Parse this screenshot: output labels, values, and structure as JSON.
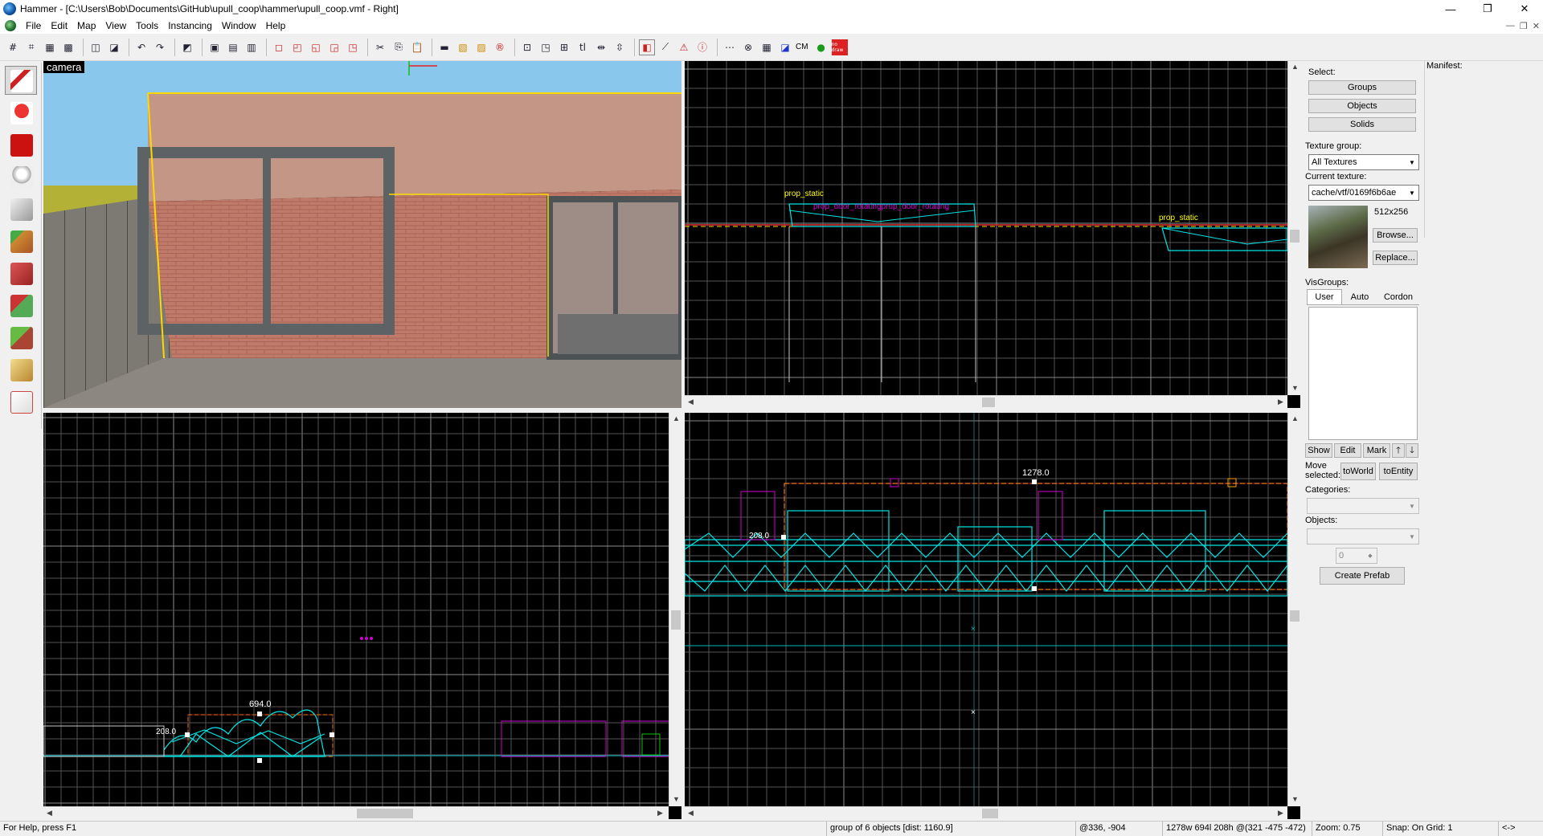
{
  "window": {
    "title": "Hammer - [C:\\Users\\Bob\\Documents\\GitHub\\upull_coop\\hammer\\upull_coop.vmf - Right]",
    "minimize": "—",
    "maximize": "❐",
    "close": "✕"
  },
  "menu": [
    "File",
    "Edit",
    "Map",
    "View",
    "Tools",
    "Instancing",
    "Window",
    "Help"
  ],
  "toolbar": {
    "cm_label": "CM",
    "nodraw_label": "no draw"
  },
  "camera_viewport": {
    "label": "camera"
  },
  "top_right_view": {
    "label_prop_static_1": "prop_static",
    "label_door": "prop_door_rotatingprop_door_rotating",
    "label_prop_static_2": "prop_static"
  },
  "bottom_left_view": {
    "width_readout": "694.0",
    "height_readout": "208.0"
  },
  "bottom_right_view": {
    "width_readout": "1278.0",
    "height_readout": "208.0"
  },
  "select_panel": {
    "title": "Select:",
    "groups": "Groups",
    "objects": "Objects",
    "solids": "Solids"
  },
  "texture_panel": {
    "group_label": "Texture group:",
    "group_value": "All Textures",
    "current_label": "Current texture:",
    "current_value": "cache/vtf/0169f6b6ae",
    "size": "512x256",
    "browse": "Browse...",
    "replace": "Replace..."
  },
  "visgroups": {
    "label": "VisGroups:",
    "tabs": [
      "User",
      "Auto",
      "Cordon"
    ],
    "show": "Show",
    "edit": "Edit",
    "mark": "Mark",
    "up": "🡑",
    "down": "🡓",
    "move_selected": "Move selected:",
    "to_world": "toWorld",
    "to_entity": "toEntity"
  },
  "prefab": {
    "categories_label": "Categories:",
    "objects_label": "Objects:",
    "count": "0",
    "create": "Create Prefab"
  },
  "manifest": {
    "label": "Manifest:"
  },
  "statusbar": {
    "help": "For Help, press F1",
    "selection": "group of 6 objects   [dist: 1160.9]",
    "cursor": "@336, -904",
    "size": "1278w 694l 208h @(321 -475 -472)",
    "zoom": "Zoom: 0.75",
    "snap": "Snap: On Grid: 1",
    "nav": "<->"
  },
  "colors": {
    "wireframe": "#00e5e5",
    "grid_minor": "#555555",
    "grid_major": "#8a8a8a",
    "axis": "#1e6e6e",
    "selection": "#ff3030",
    "selection_dash": "#ffd800",
    "entity_label": "#ffff00",
    "magenta": "#d000d0"
  }
}
